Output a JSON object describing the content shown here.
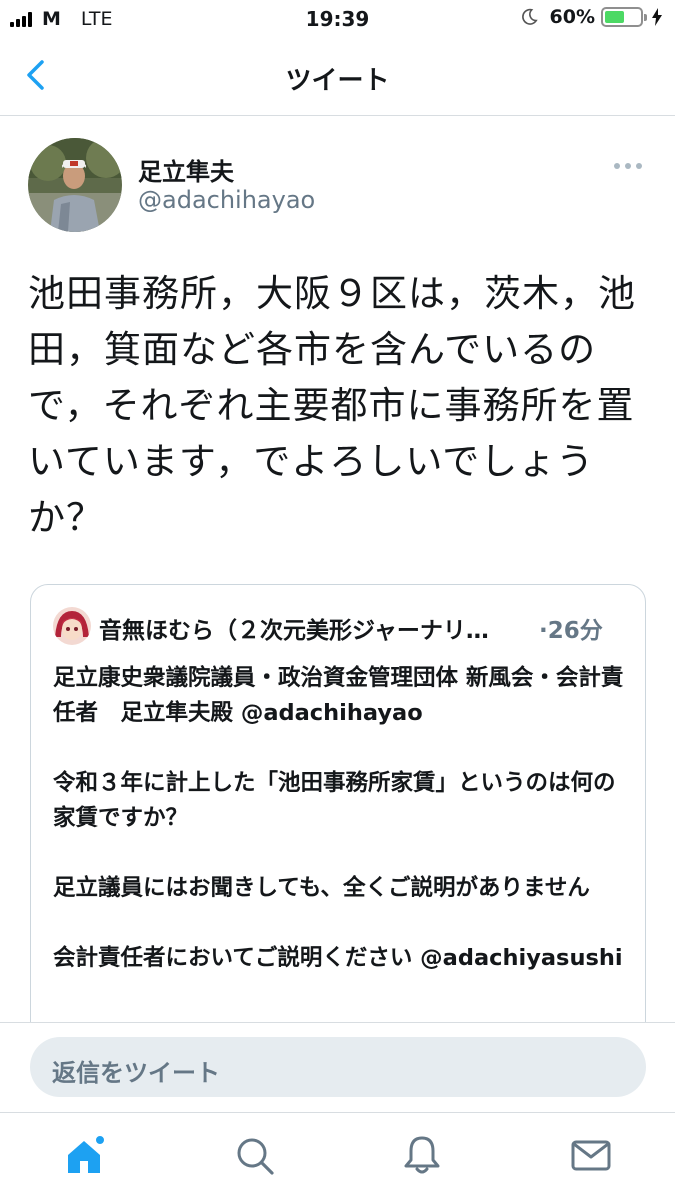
{
  "status_bar": {
    "carrier": "M",
    "network": "LTE",
    "time": "19:39",
    "battery_percent": "60%",
    "battery_level": 0.6,
    "icons": [
      "signal-icon",
      "moon-icon",
      "battery-icon",
      "bolt-icon"
    ]
  },
  "nav": {
    "title": "ツイート",
    "back_icon": "chevron-left-icon"
  },
  "tweet": {
    "author_name": "足立隼夫",
    "author_handle": "@adachihayao",
    "text": "池田事務所，大阪９区は，茨木，池田，箕面など各市を含んでいるので，それぞれ主要都市に事務所を置いています，でよろしいでしょうか？",
    "more_icon": "more-horizontal-icon"
  },
  "quote": {
    "author": "音無ほむら（２次元美形ジャーナリ…",
    "time": "·26分",
    "paragraphs": [
      "足立康史衆議院議員・政治資金管理団体 新風会・会計責任者　足立隼夫殿 @adachihayao",
      "令和３年に計上した「池田事務所家賃」というのは何の家賃ですか？",
      "足立議員にはお聞きしても、全くご説明がありません",
      "会計責任者においてご説明ください @adachiyasushi"
    ]
  },
  "reply": {
    "placeholder": "返信をツイート"
  },
  "tab_bar": {
    "items": [
      "home-icon",
      "search-icon",
      "notifications-icon",
      "messages-icon"
    ]
  },
  "colors": {
    "accent": "#1da1f2",
    "text": "#14171a",
    "secondary": "#657786",
    "border": "#ccd6dd"
  }
}
